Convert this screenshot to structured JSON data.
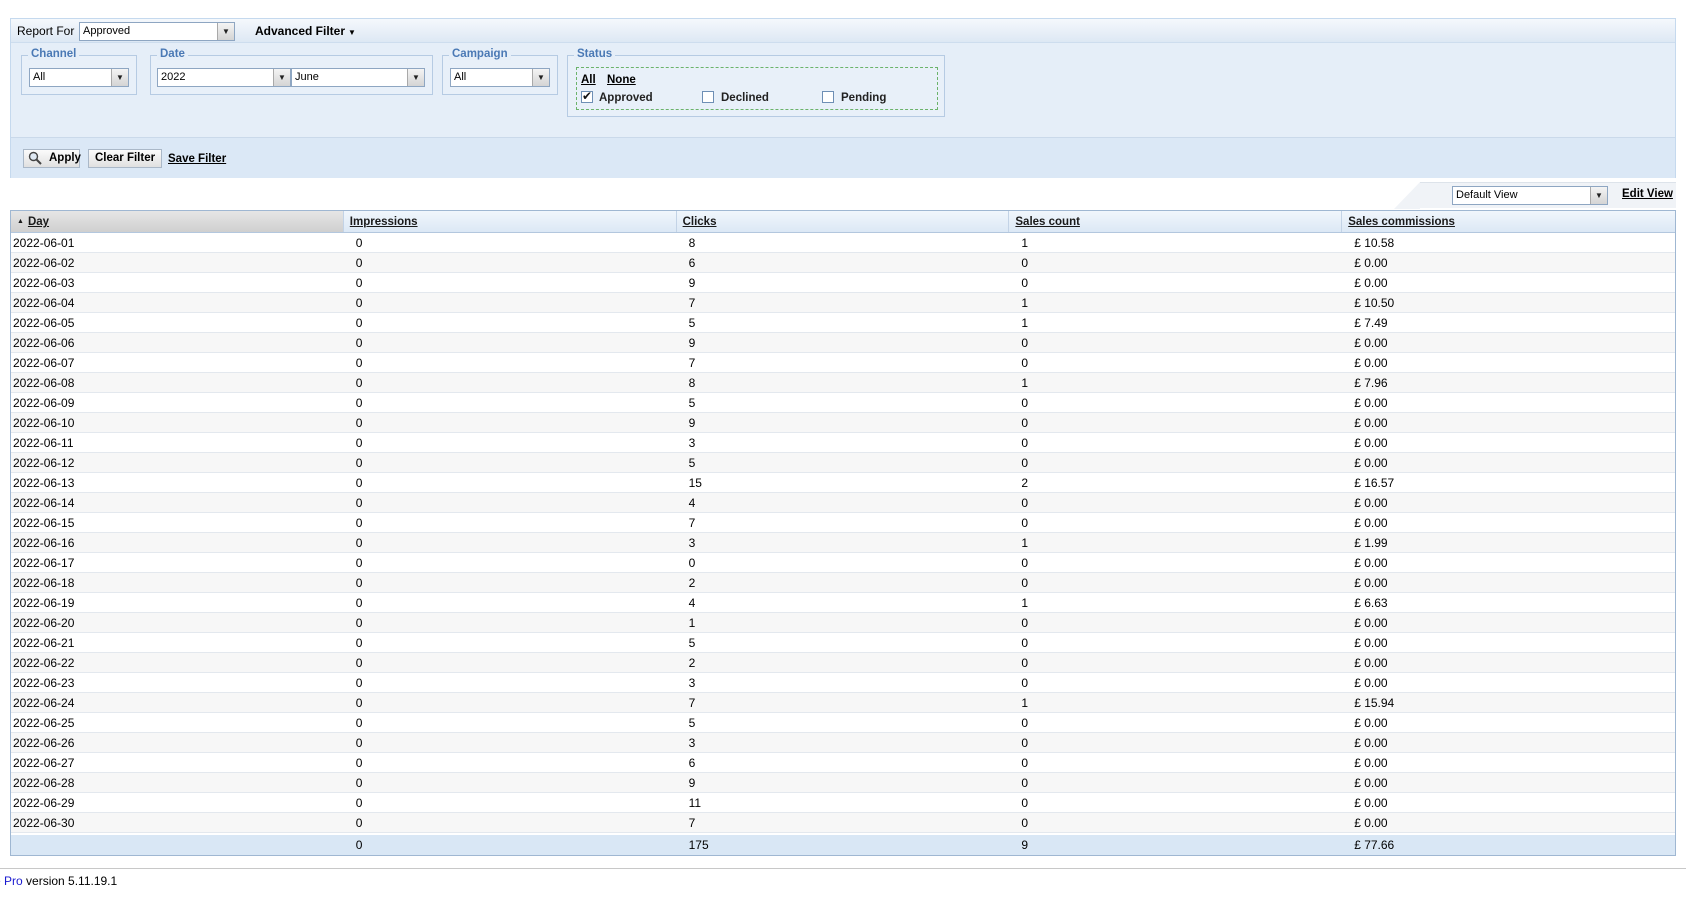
{
  "report": {
    "label": "Report For",
    "value": "Approved",
    "advanced_filter": "Advanced Filter"
  },
  "filters": {
    "channel": {
      "legend": "Channel",
      "value": "All"
    },
    "date": {
      "legend": "Date",
      "year": "2022",
      "month": "June"
    },
    "campaign": {
      "legend": "Campaign",
      "value": "All"
    },
    "status": {
      "legend": "Status",
      "all": "All",
      "none": "None",
      "options": [
        {
          "label": "Approved",
          "checked": true
        },
        {
          "label": "Declined",
          "checked": false
        },
        {
          "label": "Pending",
          "checked": false
        }
      ]
    }
  },
  "actions": {
    "apply": "Apply",
    "clear": "Clear Filter",
    "save": "Save Filter"
  },
  "view": {
    "selected": "Default View",
    "edit": "Edit View"
  },
  "table": {
    "columns": [
      "Day",
      "Impressions",
      "Clicks",
      "Sales count",
      "Sales commissions"
    ],
    "sorted_column": "Day",
    "rows": [
      [
        "2022-06-01",
        "0",
        "8",
        "1",
        "£ 10.58"
      ],
      [
        "2022-06-02",
        "0",
        "6",
        "0",
        "£ 0.00"
      ],
      [
        "2022-06-03",
        "0",
        "9",
        "0",
        "£ 0.00"
      ],
      [
        "2022-06-04",
        "0",
        "7",
        "1",
        "£ 10.50"
      ],
      [
        "2022-06-05",
        "0",
        "5",
        "1",
        "£ 7.49"
      ],
      [
        "2022-06-06",
        "0",
        "9",
        "0",
        "£ 0.00"
      ],
      [
        "2022-06-07",
        "0",
        "7",
        "0",
        "£ 0.00"
      ],
      [
        "2022-06-08",
        "0",
        "8",
        "1",
        "£ 7.96"
      ],
      [
        "2022-06-09",
        "0",
        "5",
        "0",
        "£ 0.00"
      ],
      [
        "2022-06-10",
        "0",
        "9",
        "0",
        "£ 0.00"
      ],
      [
        "2022-06-11",
        "0",
        "3",
        "0",
        "£ 0.00"
      ],
      [
        "2022-06-12",
        "0",
        "5",
        "0",
        "£ 0.00"
      ],
      [
        "2022-06-13",
        "0",
        "15",
        "2",
        "£ 16.57"
      ],
      [
        "2022-06-14",
        "0",
        "4",
        "0",
        "£ 0.00"
      ],
      [
        "2022-06-15",
        "0",
        "7",
        "0",
        "£ 0.00"
      ],
      [
        "2022-06-16",
        "0",
        "3",
        "1",
        "£ 1.99"
      ],
      [
        "2022-06-17",
        "0",
        "0",
        "0",
        "£ 0.00"
      ],
      [
        "2022-06-18",
        "0",
        "2",
        "0",
        "£ 0.00"
      ],
      [
        "2022-06-19",
        "0",
        "4",
        "1",
        "£ 6.63"
      ],
      [
        "2022-06-20",
        "0",
        "1",
        "0",
        "£ 0.00"
      ],
      [
        "2022-06-21",
        "0",
        "5",
        "0",
        "£ 0.00"
      ],
      [
        "2022-06-22",
        "0",
        "2",
        "0",
        "£ 0.00"
      ],
      [
        "2022-06-23",
        "0",
        "3",
        "0",
        "£ 0.00"
      ],
      [
        "2022-06-24",
        "0",
        "7",
        "1",
        "£ 15.94"
      ],
      [
        "2022-06-25",
        "0",
        "5",
        "0",
        "£ 0.00"
      ],
      [
        "2022-06-26",
        "0",
        "3",
        "0",
        "£ 0.00"
      ],
      [
        "2022-06-27",
        "0",
        "6",
        "0",
        "£ 0.00"
      ],
      [
        "2022-06-28",
        "0",
        "9",
        "0",
        "£ 0.00"
      ],
      [
        "2022-06-29",
        "0",
        "11",
        "0",
        "£ 0.00"
      ],
      [
        "2022-06-30",
        "0",
        "7",
        "0",
        "£ 0.00"
      ]
    ],
    "totals": [
      "",
      "0",
      "175",
      "9",
      "£ 77.66"
    ]
  },
  "footer": {
    "brand": "e Pro",
    "version": " version 5.11.19.1"
  }
}
